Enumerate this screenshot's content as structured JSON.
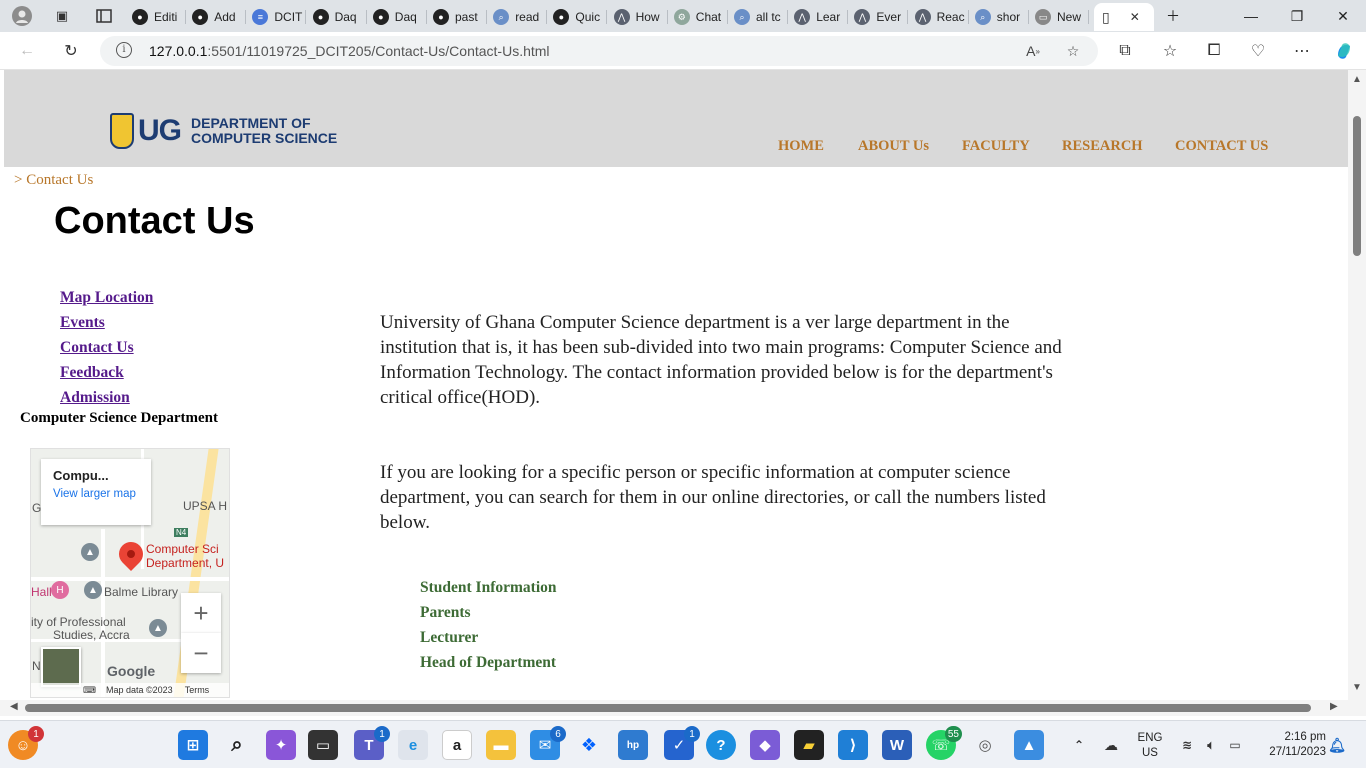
{
  "browser": {
    "tabs": [
      {
        "label": "Editi",
        "icon": "github-icon"
      },
      {
        "label": "Add",
        "icon": "github-icon"
      },
      {
        "label": "DCIT",
        "icon": "docs-icon"
      },
      {
        "label": "Daq",
        "icon": "github-icon"
      },
      {
        "label": "Daq",
        "icon": "github-icon"
      },
      {
        "label": "past",
        "icon": "github-icon"
      },
      {
        "label": "read",
        "icon": "search-icon"
      },
      {
        "label": "Quic",
        "icon": "github-icon"
      },
      {
        "label": "How",
        "icon": "site-icon"
      },
      {
        "label": "Chat",
        "icon": "chatgpt-icon"
      },
      {
        "label": "all tc",
        "icon": "search-icon"
      },
      {
        "label": "Lear",
        "icon": "site-icon"
      },
      {
        "label": "Ever",
        "icon": "site-icon"
      },
      {
        "label": "Reac",
        "icon": "site-icon"
      },
      {
        "label": "shor",
        "icon": "search-icon"
      },
      {
        "label": "New",
        "icon": "newtab-icon"
      }
    ],
    "url_host": "127.0.0.1",
    "url_rest": ":5501/11019725_DCIT205/Contact-Us/Contact-Us.html"
  },
  "site": {
    "logo_ug": "UG",
    "logo_line1": "DEPARTMENT OF",
    "logo_line2": "COMPUTER SCIENCE",
    "nav": [
      "HOME",
      "ABOUT Us",
      "FACULTY",
      "RESEARCH",
      "CONTACT US"
    ],
    "breadcrumb": "> Contact Us",
    "title": "Contact Us",
    "side_links": [
      "Map Location",
      "Events",
      "Contact Us",
      "Feedback",
      "Admission"
    ],
    "dept_label": "Computer Science Department",
    "paragraphs": [
      "University of Ghana Computer Science department is a ver large department in the institution that is, it has been sub-divided into two main programs: Computer Science and Information Technology. The contact information provided below is for the department's critical office(HOD).",
      "If you are looking for a specific person or specific information at computer science department, you can search for them in our online directories, or call the numbers listed below."
    ],
    "contacts": [
      "Student Information",
      "Parents",
      "Lecturer",
      "Head of Department"
    ]
  },
  "map": {
    "card_title": "Compu...",
    "card_link": "View larger map",
    "pin_label_1": "Computer Sci",
    "pin_label_2": "Department, U",
    "label_upsa": "UPSA H",
    "label_n4": "N4",
    "label_balme": "Balme Library",
    "label_ity": "ity of Professional",
    "label_studies": "Studies, Accra",
    "label_hall": "Hall",
    "label_g": "G",
    "label_n": "N",
    "attribution": "Map data ©2023",
    "terms": "Terms",
    "google": "Google",
    "zoom_in": "+",
    "zoom_out": "−"
  },
  "taskbar": {
    "badges": {
      "teams": "1",
      "mail": "6",
      "todo": "1",
      "whatsapp": "55",
      "user": "1"
    },
    "lang_line1": "ENG",
    "lang_line2": "US",
    "time": "2:16 pm",
    "date": "27/11/2023"
  }
}
